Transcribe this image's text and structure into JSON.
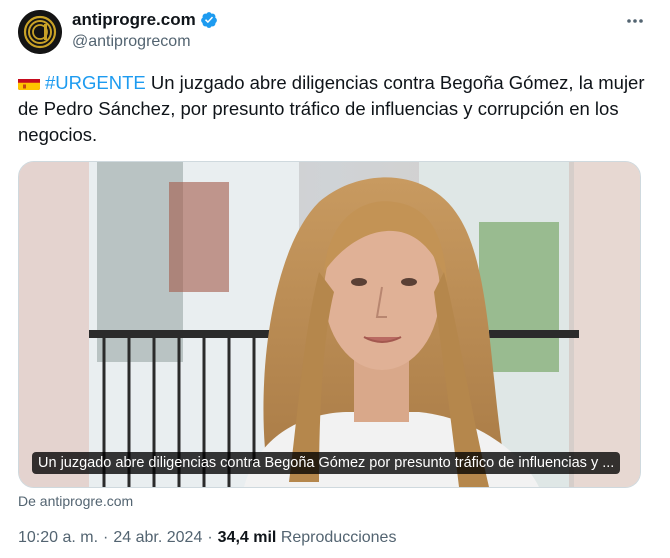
{
  "author": {
    "display_name": "antiprogre.com",
    "handle": "@antiprogrecom",
    "verified": true
  },
  "tweet": {
    "hashtag": "#URGENTE",
    "text": " Un juzgado abre diligencias contra Begoña Gómez, la mujer de Pedro Sánchez, por presunto tráfico de influencias y corrupción en los negocios."
  },
  "media": {
    "caption": "Un juzgado abre diligencias contra Begoña Gómez por presunto tráfico de influencias y ..."
  },
  "source": "De antiprogre.com",
  "meta": {
    "time": "10:20 a. m.",
    "date": "24 abr. 2024",
    "views_count": "34,4 mil",
    "views_label": "Reproducciones",
    "separator": "·"
  },
  "colors": {
    "accent": "#1d9bf0",
    "secondary_text": "#536471",
    "primary_text": "#0f1419"
  },
  "icons": [
    "avatar-logo",
    "verified-badge",
    "more-options",
    "spain-flag"
  ]
}
